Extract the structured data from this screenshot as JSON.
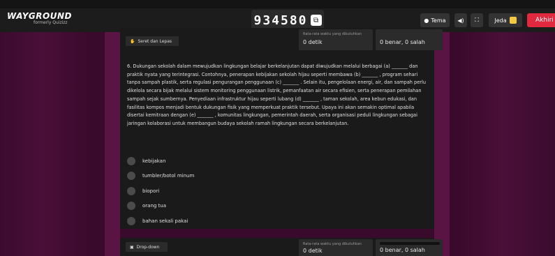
{
  "header": {
    "logo_name": "WAYGROUND",
    "logo_sub": "formerly Quizizz",
    "game_code": "934580",
    "tema_label": "Tema",
    "jeda_label": "Jeda",
    "akhiri_label": "Akhiri"
  },
  "card1": {
    "type_label": "Seret dan Lepas",
    "time_label": "Rata-rata waktu yang dibutuhkan",
    "time_value": "0 detik",
    "score_value": "0 benar, 0 salah",
    "question": "6. Dukungan sekolah dalam mewujudkan lingkungan belajar berkelanjutan dapat diwujudkan melalui berbagai (a) _______ dan praktik nyata yang terintegrasi. Contohnya, penerapan kebijakan sekolah hijau seperti membawa (b) _______ , program sehari tanpa sampah plastik, serta regulasi pengurangan penggunaan (c) _______ . Selain itu, pengelolaan energi, air, dan sampah perlu dikelola secara bijak melalui sistem monitoring penggunaan listrik, pemanfaatan air secara efisien, serta penerapan pemilahan sampah sejak sumbernya. Penyediaan infrastruktur hijau seperti lubang (d) _______ , taman sekolah, area kebun edukasi, dan fasilitas kompos menjadi bentuk dukungan fisik yang memperkuat praktik tersebut. Upaya ini akan semakin optimal apabila disertai kemitraan dengan (e) _______ , komunitas lingkungan, pemerintah daerah, serta organisasi peduli lingkungan sebagai jaringan kolaborasi untuk membangun budaya sekolah ramah lingkungan secara berkelanjutan.",
    "options": [
      "kebijakan",
      "tumbler/botol minum",
      "biopori",
      "orang tua",
      "bahan sekali pakai"
    ]
  },
  "card2": {
    "type_label": "Drop-down",
    "time_label": "Rata-rata waktu yang dibutuhkan",
    "time_value": "0 detik",
    "score_value": "0 benar, 0 salah"
  },
  "colors": {
    "accent_red": "#e0283f",
    "pause_yellow": "#f3c845",
    "background": "#3a0a2c"
  }
}
